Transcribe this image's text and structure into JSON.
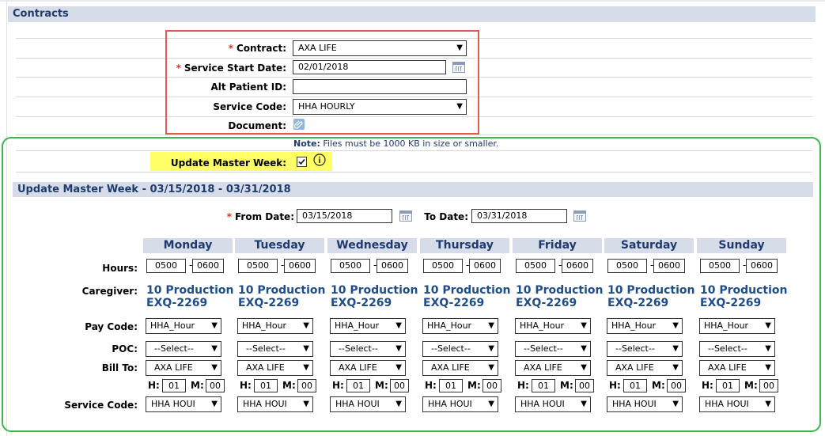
{
  "contracts": {
    "title": "Contracts",
    "contract_label": "Contract:",
    "contract_value": "AXA LIFE",
    "start_label": "Service Start Date:",
    "start_value": "02/01/2018",
    "alt_label": "Alt Patient ID:",
    "alt_value": "",
    "service_label": "Service Code:",
    "service_value": "HHA HOURLY",
    "document_label": "Document:",
    "note_bold": "Note:",
    "note_text": " Files must be 1000 KB in size or smaller.",
    "update_label": "Update Master Week:",
    "required_mark": "*"
  },
  "master_week": {
    "title": "Update Master Week - 03/15/2018 - 03/31/2018",
    "from_label": "From Date:",
    "from_value": "03/15/2018",
    "to_label": "To Date:",
    "to_value": "03/31/2018",
    "row_labels": {
      "hours": "Hours:",
      "caregiver": "Caregiver:",
      "pay_code": "Pay Code:",
      "poc": "POC:",
      "bill_to": "Bill To:",
      "service_code": "Service Code:"
    },
    "h_label": "H:",
    "m_label": "M:",
    "dash": "-",
    "days": [
      {
        "name": "Monday",
        "start": "0500",
        "end": "0600",
        "caregiver_line1": "10 Production",
        "caregiver_line2": "EXQ-2269",
        "pay_code": "HHA_Hour",
        "poc": "--Select--",
        "bill_to": "AXA LIFE",
        "h": "01",
        "m": "00",
        "service_code": "HHA HOUI"
      },
      {
        "name": "Tuesday",
        "start": "0500",
        "end": "0600",
        "caregiver_line1": "10 Production",
        "caregiver_line2": "EXQ-2269",
        "pay_code": "HHA_Hour",
        "poc": "--Select--",
        "bill_to": "AXA LIFE",
        "h": "01",
        "m": "00",
        "service_code": "HHA HOUI"
      },
      {
        "name": "Wednesday",
        "start": "0500",
        "end": "0600",
        "caregiver_line1": "10 Production",
        "caregiver_line2": "EXQ-2269",
        "pay_code": "HHA_Hour",
        "poc": "--Select--",
        "bill_to": "AXA LIFE",
        "h": "01",
        "m": "00",
        "service_code": "HHA HOUI"
      },
      {
        "name": "Thursday",
        "start": "0500",
        "end": "0600",
        "caregiver_line1": "10 Production",
        "caregiver_line2": "EXQ-2269",
        "pay_code": "HHA_Hour",
        "poc": "--Select--",
        "bill_to": "AXA LIFE",
        "h": "01",
        "m": "00",
        "service_code": "HHA HOUI"
      },
      {
        "name": "Friday",
        "start": "0500",
        "end": "0600",
        "caregiver_line1": "10 Production",
        "caregiver_line2": "EXQ-2269",
        "pay_code": "HHA_Hour",
        "poc": "--Select--",
        "bill_to": "AXA LIFE",
        "h": "01",
        "m": "00",
        "service_code": "HHA HOUI"
      },
      {
        "name": "Saturday",
        "start": "0500",
        "end": "0600",
        "caregiver_line1": "10 Production",
        "caregiver_line2": "EXQ-2269",
        "pay_code": "HHA_Hour",
        "poc": "--Select--",
        "bill_to": "AXA LIFE",
        "h": "01",
        "m": "00",
        "service_code": "HHA HOUI"
      },
      {
        "name": "Sunday",
        "start": "0500",
        "end": "0600",
        "caregiver_line1": "10 Production",
        "caregiver_line2": "EXQ-2269",
        "pay_code": "HHA_Hour",
        "poc": "--Select--",
        "bill_to": "AXA LIFE",
        "h": "01",
        "m": "00",
        "service_code": "HHA HOUI"
      }
    ]
  },
  "icons": {
    "dropdown": "chevron-down-icon",
    "calendar": "calendar-icon",
    "attach": "paperclip-icon",
    "info": "info-icon",
    "check": "checkbox-icon"
  },
  "colors": {
    "section_header_bg": "#d7dde8",
    "section_header_text": "#1f3a6e",
    "red_highlight": "#e05a50",
    "green_highlight": "#3cb54a",
    "yellow_highlight": "#ffff66",
    "required": "#e0301e",
    "caregiver_text": "#1f4c8a"
  }
}
